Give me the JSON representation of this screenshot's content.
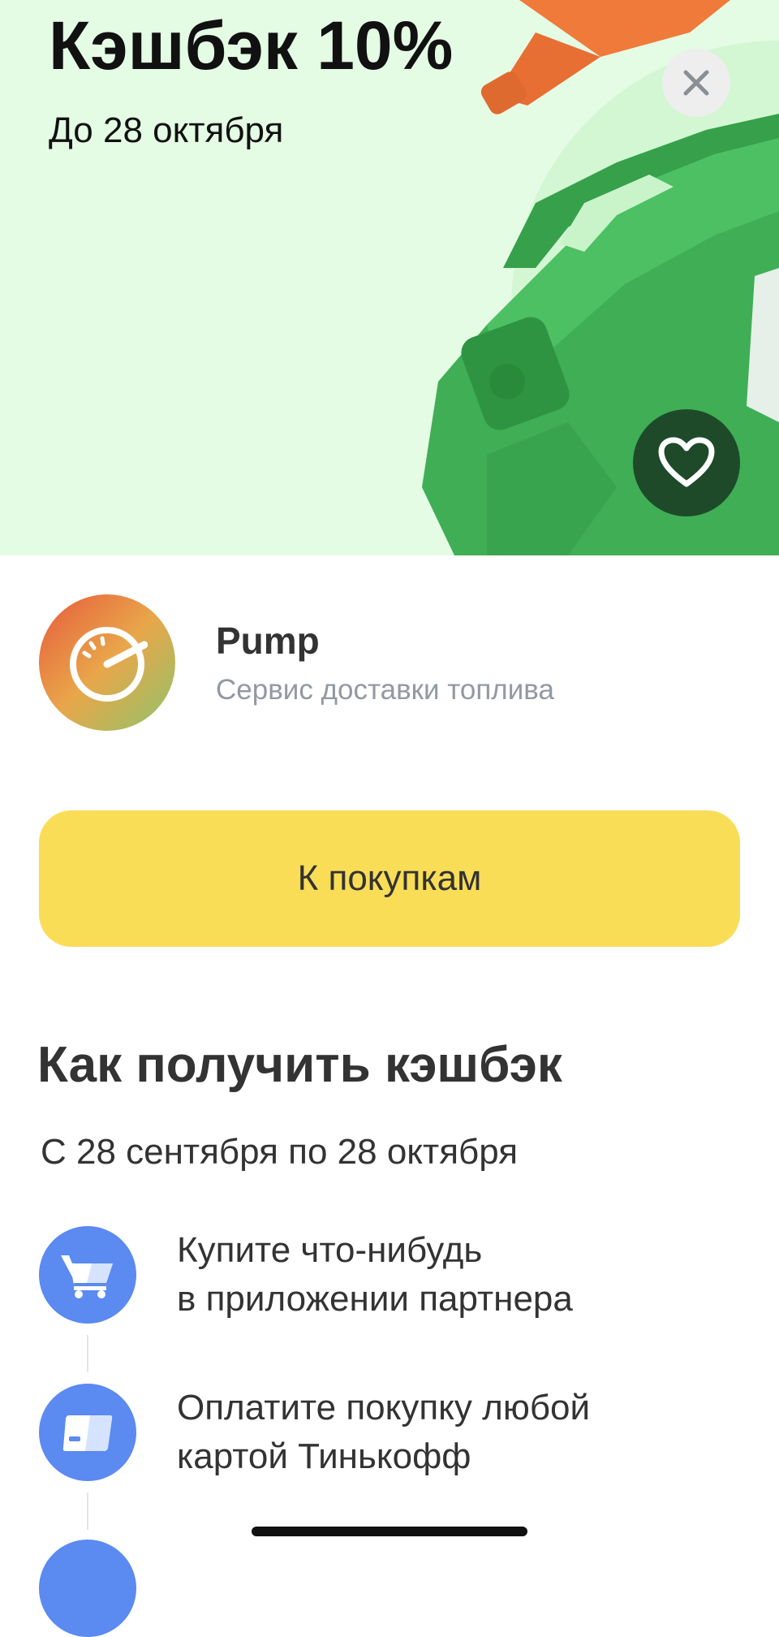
{
  "hero": {
    "title": "Кэшбэк 10%",
    "subtitle": "До 28 октября",
    "close_icon": "close-icon",
    "favorite_icon": "heart-icon",
    "background_color": "#e4fbe4",
    "canister_color": "#3fae55"
  },
  "partner": {
    "name": "Pump",
    "description": "Сервис доставки топлива",
    "logo_icon": "speedometer-icon"
  },
  "cta": {
    "label": "К покупкам",
    "color": "#f9dd57"
  },
  "how_to": {
    "title": "Как получить кэшбэк",
    "period": "С 28 сентября по 28 октября",
    "steps": [
      {
        "icon": "cart-icon",
        "line1": "Купите что-нибудь",
        "line2": "в приложении партнера"
      },
      {
        "icon": "card-icon",
        "line1": "Оплатите покупку любой",
        "line2": "картой Тинькофф"
      }
    ],
    "step_icon_color": "#5b8af0"
  }
}
